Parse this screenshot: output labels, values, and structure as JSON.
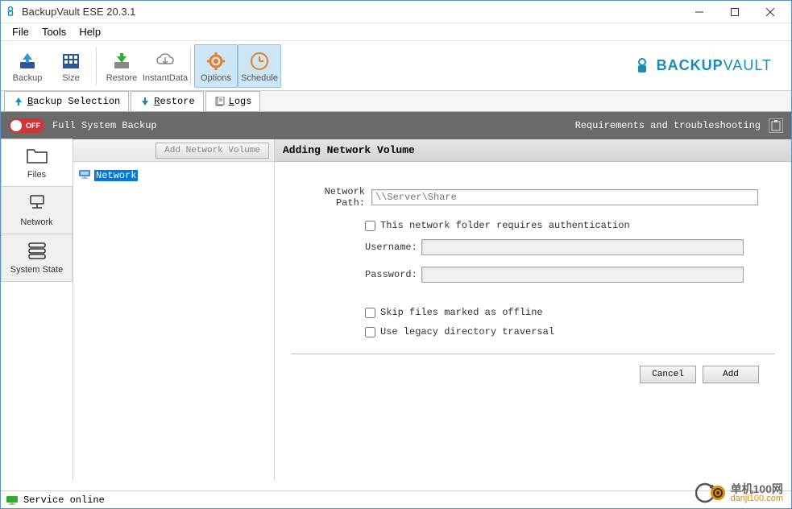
{
  "window": {
    "title": "BackupVault ESE 20.3.1"
  },
  "menu": {
    "file": "File",
    "tools": "Tools",
    "help": "Help"
  },
  "toolbar": {
    "backup": "Backup",
    "size": "Size",
    "restore": "Restore",
    "instant": "InstantData",
    "options": "Options",
    "schedule": "Schedule"
  },
  "brand": {
    "prefix": "BACKUP",
    "suffix": "VAULT"
  },
  "tabs": {
    "backup": "Backup Selection",
    "restore": "Restore",
    "logs": "Logs"
  },
  "greybar": {
    "full_backup": "Full System Backup",
    "req": "Requirements and troubleshooting",
    "toggle_label": "OFF"
  },
  "sidetabs": {
    "files": "Files",
    "network": "Network",
    "system_state": "System State"
  },
  "tree": {
    "add_btn": "Add Network Volume",
    "network_item": "Network"
  },
  "form": {
    "title": "Adding Network Volume",
    "network_path_label": "Network Path:",
    "network_path_placeholder": "\\\\Server\\Share",
    "auth_check": "This network folder requires authentication",
    "username_label": "Username:",
    "password_label": "Password:",
    "skip_offline": "Skip files marked as offline",
    "legacy_traversal": "Use legacy directory traversal",
    "cancel": "Cancel",
    "add": "Add"
  },
  "status": {
    "text": "Service online"
  },
  "watermark": {
    "top": "单机100网",
    "bottom": "danji100.com"
  }
}
